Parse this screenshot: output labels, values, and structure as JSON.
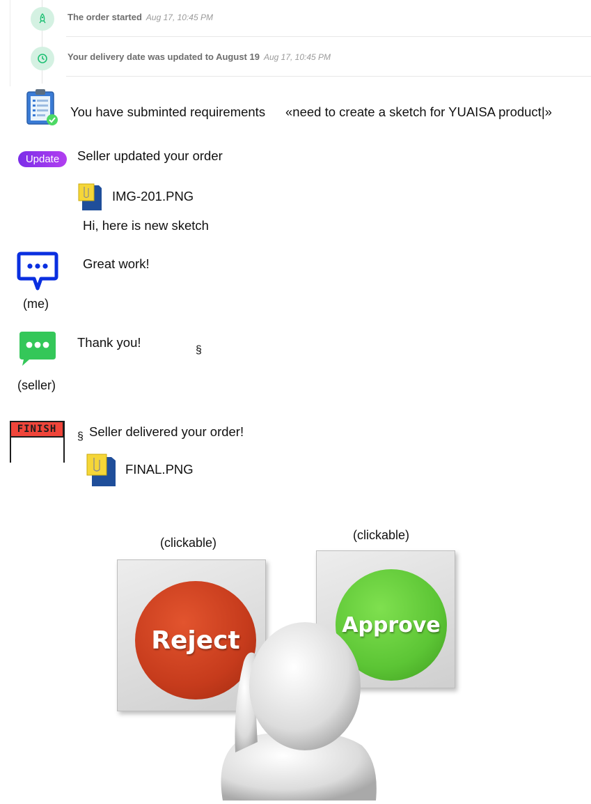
{
  "timeline": [
    {
      "text": "The order started",
      "time": "Aug 17, 10:45 PM",
      "icon": "rocket-icon"
    },
    {
      "text": "Your delivery date was updated to August 19",
      "time": "Aug 17, 10:45 PM",
      "icon": "clock-icon"
    }
  ],
  "requirements": {
    "prefix": "You have subminted requirements",
    "quote": "«need to create a sketch for YUAISA product|»"
  },
  "update": {
    "badge": "Update",
    "text": "Seller updated your order",
    "file": "IMG-201.PNG",
    "message": "Hi, here is new sketch"
  },
  "me": {
    "message": "Great work!",
    "caption": "(me)"
  },
  "seller": {
    "message": "Thank you!",
    "mark": "§",
    "caption": "(seller)"
  },
  "delivery": {
    "badge": "FINISH",
    "mark": "§",
    "text": "Seller delivered your order!",
    "file": "FINAL.PNG"
  },
  "actions": {
    "reject": {
      "label": "Reject",
      "caption": "(clickable)",
      "color": "#c63b1c"
    },
    "approve": {
      "label": "Approve",
      "caption": "(clickable)",
      "color": "#5cc535"
    }
  },
  "colors": {
    "accent_green": "#1dbf73",
    "timeline_icon_bg": "#d4f1e2",
    "update_purple": "#8a2be2",
    "chat_blue": "#0a2fe0",
    "chat_green": "#34c759"
  }
}
